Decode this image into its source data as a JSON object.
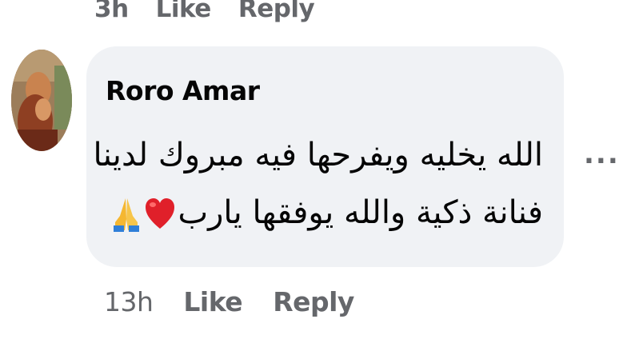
{
  "previous_comment": {
    "time": "3h",
    "like_label": "Like",
    "reply_label": "Reply"
  },
  "comment": {
    "author": "Roro Amar",
    "text_line1": "الله يخليه ويفرحها فيه مبروك لدينا",
    "text_line2": "فنانة ذكية والله يوفقها يارب",
    "emojis": [
      "heart-emoji",
      "folded-hands-emoji"
    ],
    "more_label": "...",
    "time": "13h",
    "like_label": "Like",
    "reply_label": "Reply"
  },
  "colors": {
    "bubble": "#f0f2f5",
    "secondary_text": "#65676b",
    "primary_text": "#050505",
    "heart": "#e0202a",
    "hands": "#f5b731"
  }
}
